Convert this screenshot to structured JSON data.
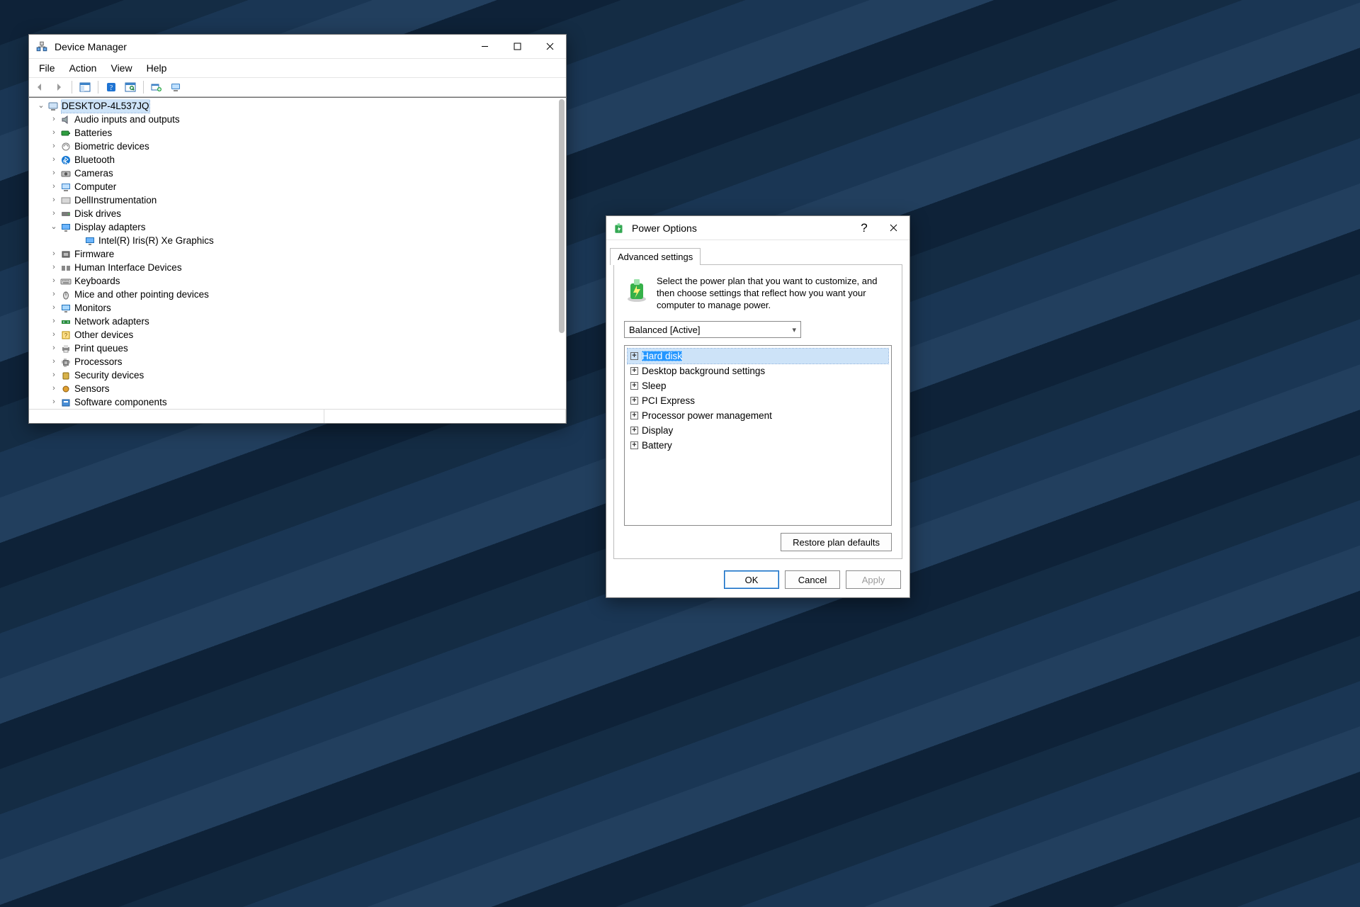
{
  "device_manager": {
    "title": "Device Manager",
    "menu": [
      "File",
      "Action",
      "View",
      "Help"
    ],
    "toolbar_icons": [
      "back-icon",
      "forward-icon",
      "show-hide-tree-icon",
      "help-icon",
      "properties-icon",
      "update-driver-icon",
      "scan-hardware-icon"
    ],
    "root": "DESKTOP-4L537JQ",
    "categories": [
      {
        "label": "Audio inputs and outputs",
        "icon": "speaker-icon",
        "expanded": false
      },
      {
        "label": "Batteries",
        "icon": "battery-icon",
        "expanded": false
      },
      {
        "label": "Biometric devices",
        "icon": "fingerprint-icon",
        "expanded": false
      },
      {
        "label": "Bluetooth",
        "icon": "bluetooth-icon",
        "expanded": false
      },
      {
        "label": "Cameras",
        "icon": "camera-icon",
        "expanded": false
      },
      {
        "label": "Computer",
        "icon": "computer-icon",
        "expanded": false
      },
      {
        "label": "DellInstrumentation",
        "icon": "generic-icon",
        "expanded": false
      },
      {
        "label": "Disk drives",
        "icon": "disk-icon",
        "expanded": false
      },
      {
        "label": "Display adapters",
        "icon": "display-icon",
        "expanded": true,
        "children": [
          {
            "label": "Intel(R) Iris(R) Xe Graphics",
            "icon": "display-icon"
          }
        ]
      },
      {
        "label": "Firmware",
        "icon": "firmware-icon",
        "expanded": false
      },
      {
        "label": "Human Interface Devices",
        "icon": "hid-icon",
        "expanded": false
      },
      {
        "label": "Keyboards",
        "icon": "keyboard-icon",
        "expanded": false
      },
      {
        "label": "Mice and other pointing devices",
        "icon": "mouse-icon",
        "expanded": false
      },
      {
        "label": "Monitors",
        "icon": "monitor-icon",
        "expanded": false
      },
      {
        "label": "Network adapters",
        "icon": "network-icon",
        "expanded": false
      },
      {
        "label": "Other devices",
        "icon": "unknown-icon",
        "expanded": false
      },
      {
        "label": "Print queues",
        "icon": "printer-icon",
        "expanded": false
      },
      {
        "label": "Processors",
        "icon": "cpu-icon",
        "expanded": false
      },
      {
        "label": "Security devices",
        "icon": "security-icon",
        "expanded": false
      },
      {
        "label": "Sensors",
        "icon": "sensor-icon",
        "expanded": false
      },
      {
        "label": "Software components",
        "icon": "software-icon",
        "expanded": false
      }
    ]
  },
  "power_options": {
    "title": "Power Options",
    "tab": "Advanced settings",
    "description": "Select the power plan that you want to customize, and then choose settings that reflect how you want your computer to manage power.",
    "plan": "Balanced [Active]",
    "settings": [
      {
        "label": "Hard disk",
        "selected": true
      },
      {
        "label": "Desktop background settings"
      },
      {
        "label": "Sleep"
      },
      {
        "label": "PCI Express"
      },
      {
        "label": "Processor power management"
      },
      {
        "label": "Display"
      },
      {
        "label": "Battery"
      }
    ],
    "restore_btn": "Restore plan defaults",
    "buttons": {
      "ok": "OK",
      "cancel": "Cancel",
      "apply": "Apply"
    }
  }
}
